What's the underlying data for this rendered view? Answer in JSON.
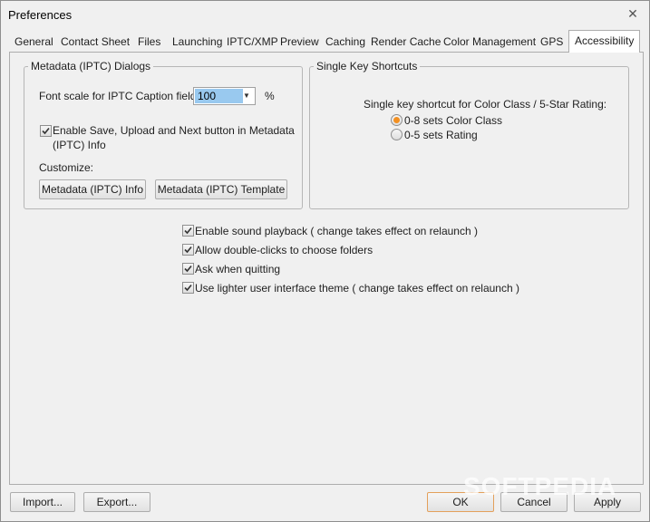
{
  "window": {
    "title": "Preferences",
    "close_glyph": "✕"
  },
  "tabs": [
    {
      "label": "General"
    },
    {
      "label": "Contact Sheet"
    },
    {
      "label": "Files"
    },
    {
      "label": "Launching"
    },
    {
      "label": "IPTC/XMP"
    },
    {
      "label": "Preview"
    },
    {
      "label": "Caching"
    },
    {
      "label": "Render Cache"
    },
    {
      "label": "Color Management"
    },
    {
      "label": "GPS"
    },
    {
      "label": "Accessibility",
      "active": true
    }
  ],
  "metadata_group": {
    "legend": "Metadata (IPTC) Dialogs",
    "font_scale_label": "Font scale for IPTC Caption field:",
    "font_scale_value": "100",
    "font_scale_unit": "%",
    "enable_save_label_line1": "Enable Save, Upload and Next button in Metadata",
    "enable_save_label_line2": "(IPTC) Info",
    "enable_save_checked": true,
    "customize_label": "Customize:",
    "info_button": "Metadata (IPTC) Info",
    "template_button": "Metadata (IPTC) Template"
  },
  "shortcuts_group": {
    "legend": "Single Key Shortcuts",
    "prompt": "Single key shortcut for Color Class / 5-Star Rating:",
    "options": [
      {
        "label": "0-8 sets Color Class",
        "selected": true
      },
      {
        "label": "0-5 sets Rating",
        "selected": false
      }
    ]
  },
  "options": [
    {
      "label": "Enable sound playback ( change takes effect on relaunch )",
      "checked": true
    },
    {
      "label": "Allow double-clicks to choose folders",
      "checked": true
    },
    {
      "label": "Ask when quitting",
      "checked": true
    },
    {
      "label": "Use lighter user interface theme ( change takes effect on relaunch )",
      "checked": true
    }
  ],
  "footer": {
    "import": "Import...",
    "export": "Export...",
    "ok": "OK",
    "cancel": "Cancel",
    "apply": "Apply"
  },
  "watermark": "SOFTPEDIA",
  "colors": {
    "accent_orange": "#f29022",
    "selection_blue": "#99c9ef"
  }
}
